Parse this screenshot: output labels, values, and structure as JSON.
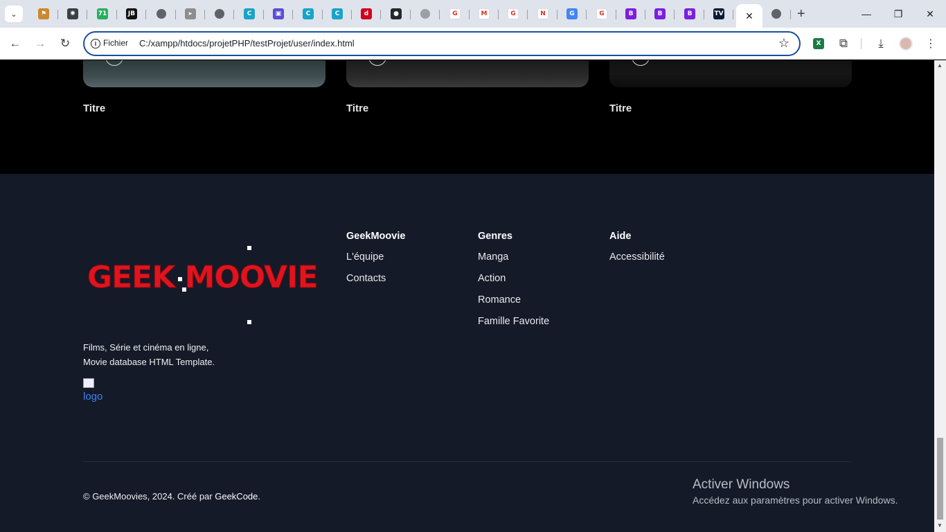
{
  "browser": {
    "tabs": [
      {
        "icon": "bookmark-icon",
        "color": "#c98a2e",
        "glyph": "⚑"
      },
      {
        "icon": "openai-icon",
        "color": "#3c4043",
        "glyph": "✺"
      },
      {
        "icon": "dashboard-icon",
        "color": "#27ae60",
        "glyph": "71"
      },
      {
        "icon": "jetbrains-icon",
        "color": "#111111",
        "glyph": "JB"
      },
      {
        "icon": "globe-icon",
        "color": "#5f6368",
        "glyph": "◍"
      },
      {
        "icon": "youtube-icon",
        "color": "#8d8d8d",
        "glyph": "▸"
      },
      {
        "icon": "globe-icon",
        "color": "#5f6368",
        "glyph": "◍"
      },
      {
        "icon": "canva-icon",
        "color": "#1aa3c9",
        "glyph": "C"
      },
      {
        "icon": "app-icon",
        "color": "#5b4bd6",
        "glyph": "▣"
      },
      {
        "icon": "canva-icon",
        "color": "#1aa3c9",
        "glyph": "C"
      },
      {
        "icon": "canva-icon",
        "color": "#1aa3c9",
        "glyph": "C"
      },
      {
        "icon": "news-icon",
        "color": "#d0021b",
        "glyph": "d"
      },
      {
        "icon": "github-icon",
        "color": "#24292e",
        "glyph": "●"
      },
      {
        "icon": "globe-icon",
        "color": "#9aa0a6",
        "glyph": "◍"
      },
      {
        "icon": "google-icon",
        "color": "#ffffff",
        "glyph": "G"
      },
      {
        "icon": "gmail-icon",
        "color": "#ffffff",
        "glyph": "M"
      },
      {
        "icon": "google-icon",
        "color": "#ffffff",
        "glyph": "G"
      },
      {
        "icon": "netflix-icon",
        "color": "#ffffff",
        "glyph": "N"
      },
      {
        "icon": "translate-icon",
        "color": "#4285f4",
        "glyph": "G"
      },
      {
        "icon": "google-icon",
        "color": "#ffffff",
        "glyph": "G"
      },
      {
        "icon": "bootstrap-icon",
        "color": "#7b1fe0",
        "glyph": "B"
      },
      {
        "icon": "bootstrap-icon",
        "color": "#7b1fe0",
        "glyph": "B"
      },
      {
        "icon": "bootstrap-icon",
        "color": "#7b1fe0",
        "glyph": "B"
      },
      {
        "icon": "tv-icon",
        "color": "#0b1a33",
        "glyph": "TV"
      }
    ],
    "active_tab_close": "✕",
    "after_tab_icon": "globe-icon",
    "new_tab": "+",
    "window": {
      "minimize": "—",
      "restore": "❐",
      "close": "✕"
    },
    "address": {
      "chip": "Fichier",
      "url": "C:/xampp/htdocs/projetPHP/testProjet/user/index.html"
    }
  },
  "cards": [
    {
      "title": "Titre"
    },
    {
      "title": "Titre"
    },
    {
      "title": "Titre"
    }
  ],
  "footer": {
    "logo_text": "GEEK MOOVIE",
    "tagline_line1": "Films, Série et cinéma en ligne,",
    "tagline_line2": "Movie database HTML Template.",
    "broken_image_alt": "logo",
    "columns": [
      {
        "heading": "GeekMoovie",
        "links": [
          "L'équipe",
          "Contacts"
        ]
      },
      {
        "heading": "Genres",
        "links": [
          "Manga",
          "Action",
          "Romance",
          "Famille Favorite"
        ]
      },
      {
        "heading": "Aide",
        "links": [
          "Accessibilité"
        ]
      }
    ],
    "copyright_prefix": "© GeekMoovies, 2024. Créé par ",
    "copyright_link": "GeekCode",
    "copyright_suffix": "."
  },
  "watermark": {
    "line1": "Activer Windows",
    "line2": "Accédez aux paramètres pour activer Windows."
  },
  "colors": {
    "logo_red": "#e0141e",
    "footer_bg": "#141a28",
    "omnibox_border": "#1a4ea0"
  }
}
